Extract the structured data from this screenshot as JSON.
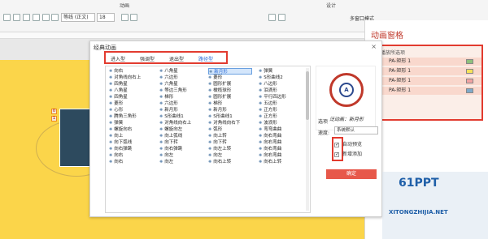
{
  "ribbon": {
    "tab_animation": "动画",
    "tab_design": "设计",
    "font_name": "等线 (正文)",
    "font_size": "18",
    "multi_window_mode": "多窗口模式"
  },
  "dialog": {
    "title": "经典动画",
    "tabs": [
      "进入型",
      "强调型",
      "退出型",
      "路径型"
    ],
    "active_tab_index": 3,
    "effects": [
      [
        "向右",
        "对角线向右上",
        "四角星",
        "八角星",
        "四角星",
        "菱形",
        "心形",
        "腾角三角形",
        "弹簧",
        "螺旋向右",
        "向上",
        "向下弧线",
        "向右弹跳",
        "向右",
        "向右"
      ],
      [
        "八角星",
        "六边形",
        "六角星",
        "等边三角形",
        "梯形",
        "六边形",
        "新月形",
        "S形曲线1",
        "对角线向右上",
        "螺旋向左",
        "向上弧线",
        "向下转",
        "向右弹跳",
        "向左",
        "向左"
      ],
      [
        "新月形",
        "菱形",
        "圆形扩展",
        "橄榄球形",
        "圆形扩展",
        "梯形",
        "新月形",
        "S形曲线1",
        "对角线向右下",
        "弧形",
        "向上转",
        "向下转",
        "向左上转",
        "向左",
        "向右上转"
      ],
      [
        "弹簧",
        "S形曲线2",
        "八边形",
        "泪滴形",
        "平行四边形",
        "五边形",
        "正方形",
        "正方形",
        "波浪形",
        "弯弯曲曲",
        "向右弯曲",
        "向右弯曲",
        "向右弯曲",
        "向右弯曲",
        "向右上转"
      ]
    ],
    "selected_effect": "新月形",
    "preview_caption": "泛动画：新月形",
    "options_label": "选项",
    "speed_label": "速度:",
    "speed_value": "系统默认",
    "checkbox_preview": "自动预览",
    "checkbox_preview_checked": true,
    "checkbox_add": "新增添加",
    "checkbox_add_checked": true,
    "ok_button": "确定",
    "close_glyph": "×"
  },
  "animation_pane": {
    "title": "动画窗格",
    "header": "播放所选项",
    "items": [
      {
        "num": "1",
        "label": "PA-矩形 1",
        "swatch": "#8ec07c"
      },
      {
        "num": "",
        "label": "PA-矩形 1",
        "swatch": "#f5e15a"
      },
      {
        "num": "",
        "label": "PA-矩形 1",
        "swatch": "#f2a2a2"
      },
      {
        "num": "",
        "label": "PA-矩形 1",
        "swatch": "#7fa9c9"
      }
    ]
  },
  "slide": {
    "tag_top": "0",
    "tag_bottom": "1"
  },
  "watermark": {
    "logo": "61PPT",
    "url": "XITONGZHIJIA.NET"
  },
  "colors": {
    "accent_red": "#e23b2f",
    "selected_blue": "#2a6bd6",
    "slide_yellow": "#fbd54a",
    "shape_dark": "#2d4a5e",
    "ok_button": "#e7584a"
  }
}
